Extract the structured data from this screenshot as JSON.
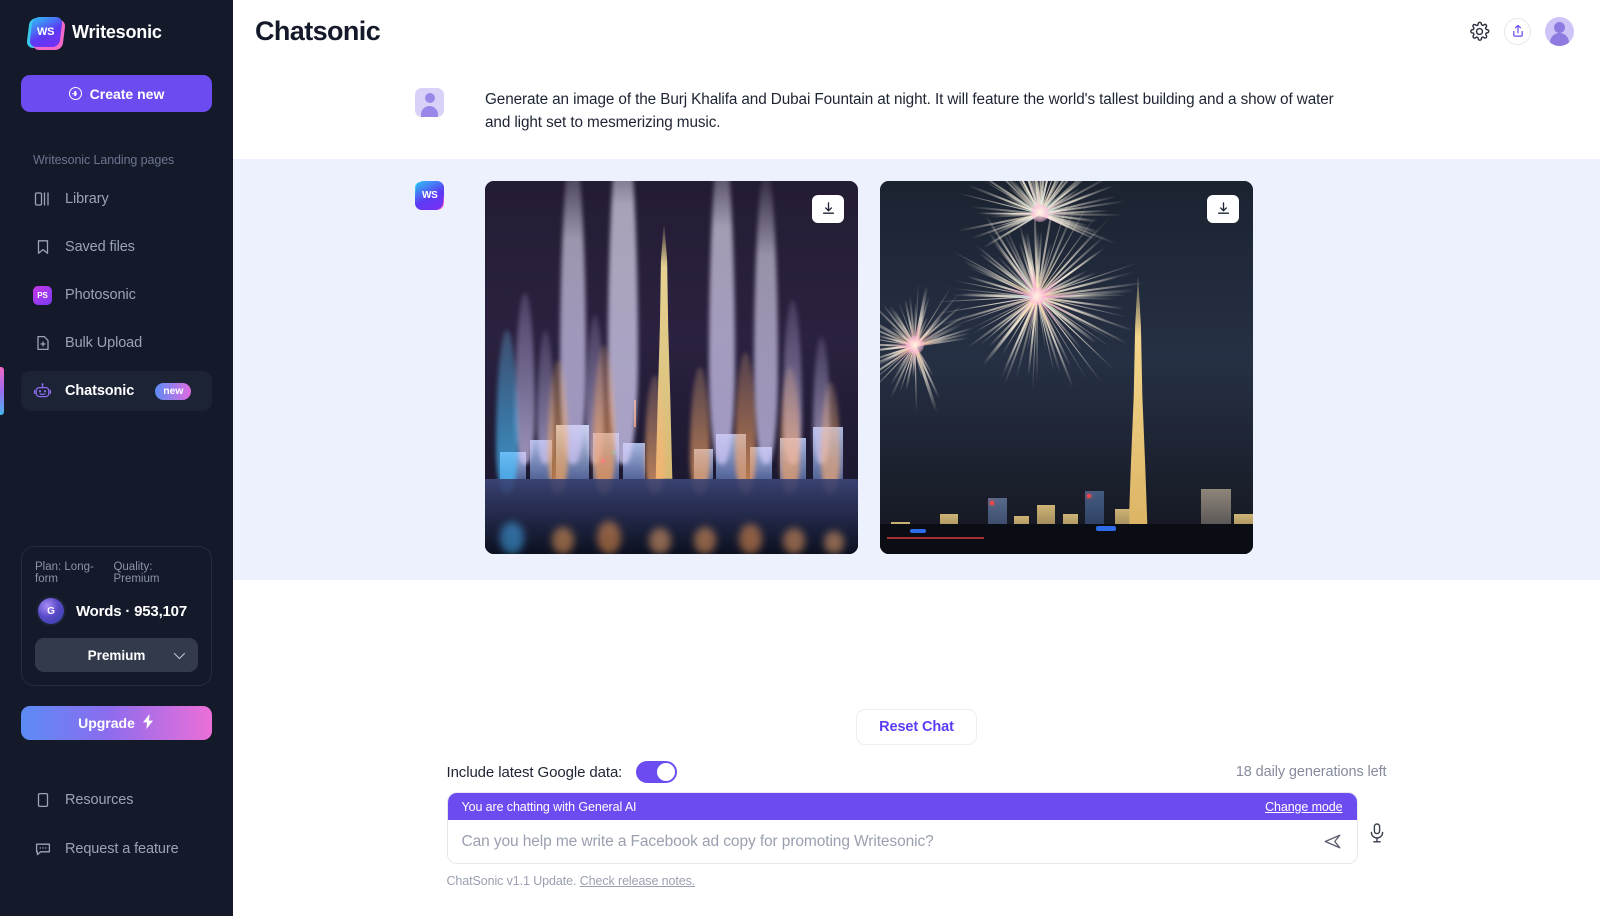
{
  "sidebar": {
    "brand": {
      "name": "Writesonic",
      "logo_text": "WS"
    },
    "create_new": {
      "label": "Create new",
      "icon": "plus-circle-icon"
    },
    "section_label": "Writesonic Landing pages",
    "items": [
      {
        "label": "Library",
        "icon": "columns-icon",
        "badge": null,
        "active": false
      },
      {
        "label": "Saved files",
        "icon": "bookmark-icon",
        "badge": null,
        "active": false
      },
      {
        "label": "Photosonic",
        "icon": "photosonic-icon",
        "icon_text": "PS",
        "badge": null,
        "active": false
      },
      {
        "label": "Bulk Upload",
        "icon": "file-plus-icon",
        "badge": null,
        "active": false
      },
      {
        "label": "Chatsonic",
        "icon": "robot-icon",
        "badge": "new",
        "active": true
      }
    ],
    "plan_card": {
      "plan": "Plan: Long-form",
      "quality": "Quality: Premium",
      "words_label": "Words",
      "separator": "·",
      "words_count": "953,107",
      "coin_icon": "coin-icon",
      "quality_select": "Premium",
      "chevron": "chevron-down-icon"
    },
    "upgrade": {
      "label": "Upgrade",
      "icon": "lightning-bolt-icon"
    },
    "bottom_items": [
      {
        "label": "Resources",
        "icon": "book-icon"
      },
      {
        "label": "Request a feature",
        "icon": "chat-bubble-icon"
      }
    ]
  },
  "header": {
    "title": "Chatsonic",
    "actions": [
      {
        "name": "settings",
        "icon": "gear-icon"
      },
      {
        "name": "share",
        "icon": "share-upload-icon"
      },
      {
        "name": "profile",
        "icon": "avatar-icon"
      }
    ]
  },
  "conversation": {
    "user_message": {
      "avatar": "user-avatar-icon",
      "text": "Generate an image of the Burj Khalifa and Dubai Fountain at night. It will feature the world's tallest building and a show of water and light set to mesmerizing music."
    },
    "bot_message": {
      "avatar": "writesonic-logo-icon",
      "images": [
        {
          "alt": "Dubai Fountain water jets lit in color with Burj Khalifa at night",
          "download_icon": "download-icon"
        },
        {
          "alt": "Fireworks bursting over the Burj Khalifa and Dubai skyline at night",
          "download_icon": "download-icon"
        }
      ]
    }
  },
  "footer": {
    "reset_chat": "Reset Chat",
    "google_data_label": "Include latest Google data:",
    "google_data_enabled": true,
    "generations_left": "18 daily generations left",
    "mode_bar": {
      "text": "You are chatting with General AI",
      "change_mode": "Change mode"
    },
    "input": {
      "placeholder": "Can you help me write a Facebook ad copy for promoting Writesonic?",
      "value": "",
      "send_icon": "send-icon",
      "mic_icon": "microphone-icon"
    },
    "version_note": {
      "prefix": "ChatSonic v1.1 Update.",
      "link": "Check release notes."
    }
  },
  "colors": {
    "sidebar_bg": "#141A2A",
    "accent_purple": "#6C4CF1",
    "bot_bubble_bg": "#EDF0FD",
    "reset_text": "#5B3DF5",
    "muted_text": "#9BA3B7"
  }
}
